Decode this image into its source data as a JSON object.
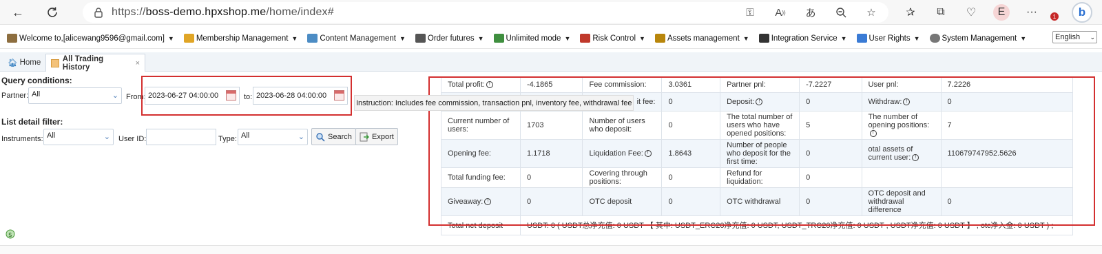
{
  "browser": {
    "url_prefix": "https://",
    "url_domain": "boss-demo.hpxshop.me",
    "url_path": "/home/index#",
    "profile_initial": "E",
    "notification_count": "1",
    "icons": [
      "back-icon",
      "refresh-icon",
      "lock-icon",
      "key-icon",
      "read-aloud-icon",
      "translate-icon",
      "zoom-icon",
      "favorite-star-icon",
      "favorites-icon",
      "collections-icon",
      "health-icon",
      "more-icon",
      "bing-icon"
    ]
  },
  "menu": {
    "items": [
      {
        "label": "Welcome to,[alicewang9596@gmail.com]",
        "color": "#8d6e3f"
      },
      {
        "label": "Membership Management",
        "color": "#e0a526"
      },
      {
        "label": "Content Management",
        "color": "#4c8cc4"
      },
      {
        "label": "Order futures",
        "color": "#555555"
      },
      {
        "label": "Unlimited mode",
        "color": "#3f8f3f"
      },
      {
        "label": "Risk Control",
        "color": "#c0392b"
      },
      {
        "label": "Assets management",
        "color": "#b8860b"
      },
      {
        "label": "Integration Service",
        "color": "#333333"
      },
      {
        "label": "User Rights",
        "color": "#3a7bd5"
      },
      {
        "label": "System Management",
        "color": "#777777"
      }
    ],
    "language": "English"
  },
  "tabs": {
    "home": "Home",
    "active": "All Trading History",
    "close": "×"
  },
  "query": {
    "title": "Query conditions:",
    "partner_label": "Partner:",
    "partner_value": "All",
    "from_label": "From:",
    "from_value": "2023-06-27 04:00:00",
    "to_label": "to:",
    "to_value": "2023-06-28 04:00:00",
    "instruction": "Instruction: Includes fee commission, transaction pnl, inventory fee, withdrawal fee"
  },
  "filter": {
    "title": "List detail filter:",
    "instruments_label": "Instruments:",
    "instruments_value": "All",
    "userid_label": "User ID:",
    "userid_value": "",
    "type_label": "Type:",
    "type_value": "All",
    "search_label": "Search",
    "export_label": "Export"
  },
  "stats": {
    "rows": [
      [
        {
          "k": "Total profit:",
          "info": true,
          "v": "-4.1865"
        },
        {
          "k": "Fee commission:",
          "v": "3.0361"
        },
        {
          "k": "Partner pnl:",
          "v": "-7.2227"
        },
        {
          "k": "User pnl:",
          "v": "7.2226"
        }
      ],
      [
        {
          "k": "",
          "v": ""
        },
        {
          "k": "it fee:",
          "v": "0"
        },
        {
          "k": "Deposit:",
          "info": true,
          "v": "0"
        },
        {
          "k": "Withdraw:",
          "info": true,
          "v": "0"
        }
      ],
      [
        {
          "k": "Current number of users:",
          "v": "1703"
        },
        {
          "k": "Number of users who deposit:",
          "v": "0"
        },
        {
          "k": "The total number of users who have opened positions:",
          "v": "5"
        },
        {
          "k": "The number of opening positions:",
          "info": true,
          "v": "7"
        }
      ],
      [
        {
          "k": "Opening fee:",
          "v": "1.1718"
        },
        {
          "k": "Liquidation Fee:",
          "info": true,
          "v": "1.8643"
        },
        {
          "k": "Number of people who deposit for the first time:",
          "v": "0"
        },
        {
          "k": "otal assets of current user:",
          "info": true,
          "v": "110679747952.5626"
        }
      ],
      [
        {
          "k": "Total funding fee:",
          "v": "0"
        },
        {
          "k": "Covering through positions:",
          "v": "0"
        },
        {
          "k": "Refund for liquidation:",
          "v": "0"
        },
        {
          "k": "",
          "v": ""
        }
      ],
      [
        {
          "k": "Giveaway:",
          "info": true,
          "v": "0"
        },
        {
          "k": "OTC deposit",
          "v": "0"
        },
        {
          "k": "OTC withdrawal",
          "v": "0"
        },
        {
          "k": "OTC deposit and withdrawal difference",
          "v": "0"
        }
      ]
    ],
    "net_label": "Total net deposit",
    "net_value": "USDT: 0 ( USDT总净充值: 0 USDT 【 其中: USDT_ERC20净充值: 0 USDT, USDT_TRC20净充值: 0 USDT , USDT净充值: 0 USDT 】 , otc净入金: 0 USDT ) ;"
  }
}
